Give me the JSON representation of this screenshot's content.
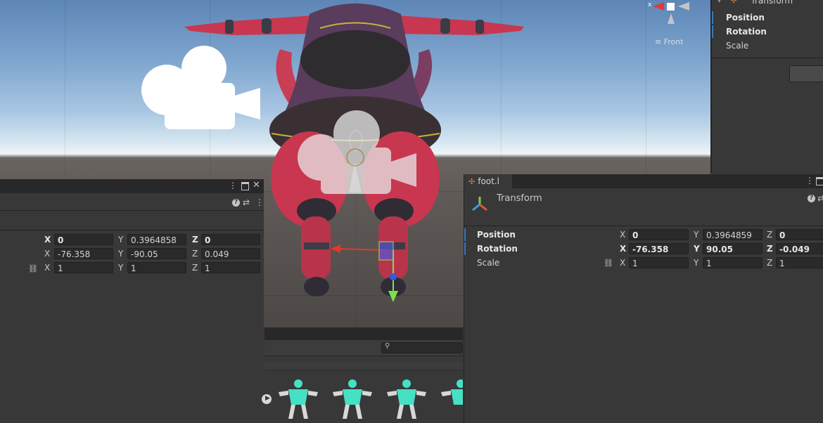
{
  "scene": {
    "view_label": "Front",
    "axis_label": "x"
  },
  "right_inspector": {
    "component_title": "Transform",
    "rows": [
      "Position",
      "Rotation",
      "Scale"
    ]
  },
  "left_inspector": {
    "position": {
      "x": "0",
      "y": "0.3964858",
      "z": "0"
    },
    "rotation": {
      "x": "-76.358",
      "y": "-90.05",
      "z": "0.049"
    },
    "scale": {
      "x": "1",
      "y": "1",
      "z": "1"
    }
  },
  "foot_inspector": {
    "tab_label": "foot.l",
    "component_title": "Transform",
    "position_label": "Position",
    "rotation_label": "Rotation",
    "scale_label": "Scale",
    "position": {
      "x": "0",
      "y": "0.3964859",
      "z": "0"
    },
    "rotation": {
      "x": "-76.358",
      "y": "90.05",
      "z": "-0.049"
    },
    "scale": {
      "x": "1",
      "y": "1",
      "z": "1"
    }
  },
  "axes": {
    "x": "X",
    "y": "Y",
    "z": "Z"
  },
  "colors": {
    "panel_bg": "#383838",
    "tab_bar": "#282828",
    "field_bg": "#2a2a2a",
    "accent_blue": "#3a79bb",
    "humanoid_icon": "#46e0c4"
  },
  "icons": [
    "kebab-menu-icon",
    "maximize-icon",
    "close-icon",
    "help-icon",
    "preset-icon",
    "link-icon",
    "transform-icon",
    "camera-gizmo-icon",
    "humanoid-avatar-icon",
    "play-icon",
    "search-icon"
  ]
}
